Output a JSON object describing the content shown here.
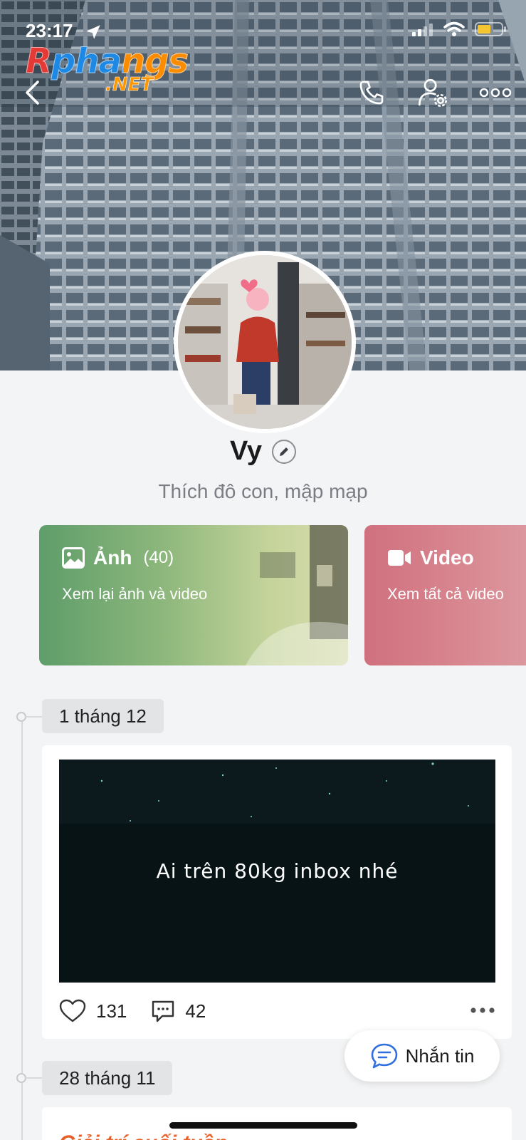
{
  "status_bar": {
    "time": "23:17",
    "icons": [
      "location-arrow-icon",
      "signal-icon",
      "wifi-icon",
      "battery-icon"
    ]
  },
  "watermark": {
    "main": "Rphangs",
    "sub": ".NET"
  },
  "header": {
    "icons": [
      "back-icon",
      "phone-icon",
      "profile-settings-icon",
      "more-icon"
    ]
  },
  "profile": {
    "name": "Vy",
    "bio": "Thích đô con, mập mạp"
  },
  "media": {
    "photos": {
      "title": "Ảnh",
      "count": "(40)",
      "subtitle": "Xem lại ảnh và video"
    },
    "videos": {
      "title": "Video",
      "subtitle": "Xem tất cả video"
    }
  },
  "timeline": [
    {
      "date": "1 tháng 12",
      "text": "Ai trên 80kg inbox nhé",
      "likes": "131",
      "comments": "42"
    },
    {
      "date": "28 tháng 11",
      "text": "Giải trí cuối tuần"
    }
  ],
  "message_button": {
    "label": "Nhắn tin"
  },
  "colors": {
    "photos_card": "#6aa06f",
    "video_card": "#d0707e",
    "accent_blue": "#2f6fe0",
    "post2_text": "#e8612b"
  }
}
